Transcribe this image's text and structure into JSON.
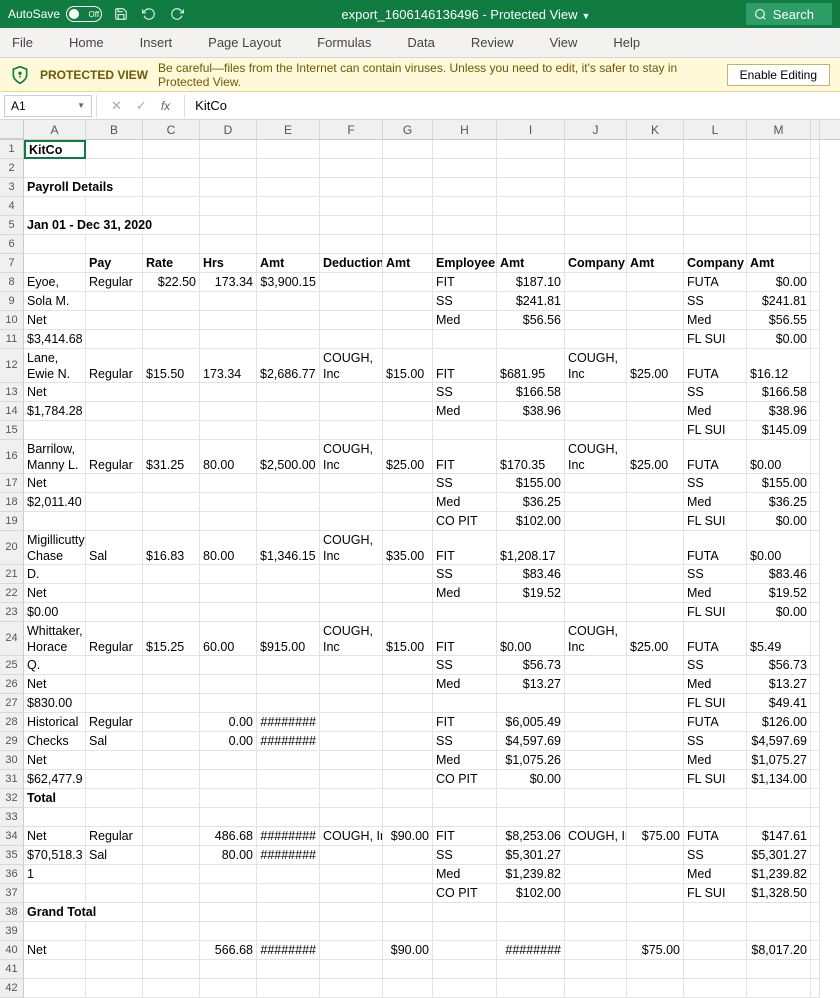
{
  "titlebar": {
    "autosave_label": "AutoSave",
    "autosave_state": "Off",
    "doc_title": "export_1606146136496  -  Protected View",
    "search_label": "Search"
  },
  "ribbon": {
    "tabs": [
      "File",
      "Home",
      "Insert",
      "Page Layout",
      "Formulas",
      "Data",
      "Review",
      "View",
      "Help"
    ]
  },
  "protected_view": {
    "title": "PROTECTED VIEW",
    "msg": "Be careful—files from the Internet can contain viruses. Unless you need to edit, it's safer to stay in Protected View.",
    "button": "Enable Editing"
  },
  "formula_bar": {
    "namebox": "A1",
    "value": "KitCo"
  },
  "columns": [
    "A",
    "B",
    "C",
    "D",
    "E",
    "F",
    "G",
    "H",
    "I",
    "J",
    "K",
    "L",
    "M",
    ""
  ],
  "rows": [
    {
      "n": 1,
      "cells": {
        "A": {
          "v": "KitCo",
          "bold": true,
          "active": true
        }
      }
    },
    {
      "n": 2,
      "cells": {}
    },
    {
      "n": 3,
      "cells": {
        "A": {
          "v": "Payroll Details",
          "bold": true,
          "span": 2
        }
      }
    },
    {
      "n": 4,
      "cells": {}
    },
    {
      "n": 5,
      "cells": {
        "A": {
          "v": "Jan 01 - Dec 31, 2020",
          "bold": true,
          "span": 3
        }
      }
    },
    {
      "n": 6,
      "cells": {}
    },
    {
      "n": 7,
      "cells": {
        "B": {
          "v": "Pay",
          "bold": true
        },
        "C": {
          "v": "Rate",
          "bold": true
        },
        "D": {
          "v": "Hrs",
          "bold": true
        },
        "E": {
          "v": "Amt",
          "bold": true
        },
        "F": {
          "v": "Deduction",
          "bold": true
        },
        "G": {
          "v": "Amt",
          "bold": true
        },
        "H": {
          "v": "Employee",
          "bold": true
        },
        "I": {
          "v": "Amt",
          "bold": true
        },
        "J": {
          "v": "Company",
          "bold": true
        },
        "K": {
          "v": "Amt",
          "bold": true
        },
        "L": {
          "v": "Company",
          "bold": true
        },
        "M": {
          "v": "Amt",
          "bold": true
        }
      }
    },
    {
      "n": 8,
      "cells": {
        "A": {
          "v": "Eyoe,"
        },
        "B": {
          "v": "Regular"
        },
        "C": {
          "v": "$22.50",
          "num": true
        },
        "D": {
          "v": "173.34",
          "num": true
        },
        "E": {
          "v": "$3,900.15",
          "num": true
        },
        "H": {
          "v": "FIT"
        },
        "I": {
          "v": "$187.10",
          "num": true
        },
        "L": {
          "v": "FUTA"
        },
        "M": {
          "v": "$0.00",
          "num": true
        }
      }
    },
    {
      "n": 9,
      "cells": {
        "A": {
          "v": "Sola M."
        },
        "H": {
          "v": "SS"
        },
        "I": {
          "v": "$241.81",
          "num": true
        },
        "L": {
          "v": "SS"
        },
        "M": {
          "v": "$241.81",
          "num": true
        }
      }
    },
    {
      "n": 10,
      "cells": {
        "A": {
          "v": "   Net"
        },
        "H": {
          "v": "Med"
        },
        "I": {
          "v": "$56.56",
          "num": true
        },
        "L": {
          "v": "Med"
        },
        "M": {
          "v": "$56.55",
          "num": true
        }
      }
    },
    {
      "n": 11,
      "cells": {
        "A": {
          "v": "$3,414.68"
        },
        "L": {
          "v": "FL SUI"
        },
        "M": {
          "v": "$0.00",
          "num": true
        }
      }
    },
    {
      "n": 12,
      "cells": {
        "A": {
          "v": "Lane, Ewie N."
        },
        "B": {
          "v": "Regular"
        },
        "C": {
          "v": "$15.50",
          "num": true
        },
        "D": {
          "v": "173.34",
          "num": true
        },
        "E": {
          "v": "$2,686.77",
          "num": true
        },
        "F": {
          "v": "COUGH, Inc"
        },
        "G": {
          "v": "$15.00",
          "num": true
        },
        "H": {
          "v": "FIT"
        },
        "I": {
          "v": "$681.95",
          "num": true
        },
        "J": {
          "v": "COUGH, Inc"
        },
        "K": {
          "v": "$25.00",
          "num": true
        },
        "L": {
          "v": "FUTA"
        },
        "M": {
          "v": "$16.12",
          "num": true
        }
      }
    },
    {
      "n": 13,
      "cells": {
        "A": {
          "v": "   Net"
        },
        "H": {
          "v": "SS"
        },
        "I": {
          "v": "$166.58",
          "num": true
        },
        "L": {
          "v": "SS"
        },
        "M": {
          "v": "$166.58",
          "num": true
        }
      }
    },
    {
      "n": 14,
      "cells": {
        "A": {
          "v": "$1,784.28"
        },
        "H": {
          "v": "Med"
        },
        "I": {
          "v": "$38.96",
          "num": true
        },
        "L": {
          "v": "Med"
        },
        "M": {
          "v": "$38.96",
          "num": true
        }
      }
    },
    {
      "n": 15,
      "cells": {
        "L": {
          "v": "FL SUI"
        },
        "M": {
          "v": "$145.09",
          "num": true
        }
      }
    },
    {
      "n": 16,
      "cells": {
        "A": {
          "v": "Barrilow, Manny L."
        },
        "B": {
          "v": "Regular"
        },
        "C": {
          "v": "$31.25",
          "num": true
        },
        "D": {
          "v": "80.00",
          "num": true
        },
        "E": {
          "v": "$2,500.00",
          "num": true
        },
        "F": {
          "v": "COUGH, Inc"
        },
        "G": {
          "v": "$25.00",
          "num": true
        },
        "H": {
          "v": "FIT"
        },
        "I": {
          "v": "$170.35",
          "num": true
        },
        "J": {
          "v": "COUGH, Inc"
        },
        "K": {
          "v": "$25.00",
          "num": true
        },
        "L": {
          "v": "FUTA"
        },
        "M": {
          "v": "$0.00",
          "num": true
        }
      }
    },
    {
      "n": 17,
      "cells": {
        "A": {
          "v": "   Net"
        },
        "H": {
          "v": "SS"
        },
        "I": {
          "v": "$155.00",
          "num": true
        },
        "L": {
          "v": "SS"
        },
        "M": {
          "v": "$155.00",
          "num": true
        }
      }
    },
    {
      "n": 18,
      "cells": {
        "A": {
          "v": "$2,011.40"
        },
        "H": {
          "v": "Med"
        },
        "I": {
          "v": "$36.25",
          "num": true
        },
        "L": {
          "v": "Med"
        },
        "M": {
          "v": "$36.25",
          "num": true
        }
      }
    },
    {
      "n": 19,
      "cells": {
        "H": {
          "v": "CO PIT"
        },
        "I": {
          "v": "$102.00",
          "num": true
        },
        "L": {
          "v": "FL SUI"
        },
        "M": {
          "v": "$0.00",
          "num": true
        }
      }
    },
    {
      "n": 20,
      "cells": {
        "A": {
          "v": "Migillicutty, Chase"
        },
        "B": {
          "v": "Sal"
        },
        "C": {
          "v": "$16.83",
          "num": true
        },
        "D": {
          "v": "80.00",
          "num": true
        },
        "E": {
          "v": "$1,346.15",
          "num": true
        },
        "F": {
          "v": "COUGH, Inc"
        },
        "G": {
          "v": "$35.00",
          "num": true
        },
        "H": {
          "v": "FIT"
        },
        "I": {
          "v": "$1,208.17",
          "num": true
        },
        "L": {
          "v": "FUTA"
        },
        "M": {
          "v": "$0.00",
          "num": true
        }
      }
    },
    {
      "n": 21,
      "cells": {
        "A": {
          "v": "D."
        },
        "H": {
          "v": "SS"
        },
        "I": {
          "v": "$83.46",
          "num": true
        },
        "L": {
          "v": "SS"
        },
        "M": {
          "v": "$83.46",
          "num": true
        }
      }
    },
    {
      "n": 22,
      "cells": {
        "A": {
          "v": "   Net"
        },
        "H": {
          "v": "Med"
        },
        "I": {
          "v": "$19.52",
          "num": true
        },
        "L": {
          "v": "Med"
        },
        "M": {
          "v": "$19.52",
          "num": true
        }
      }
    },
    {
      "n": 23,
      "cells": {
        "A": {
          "v": "$0.00"
        },
        "L": {
          "v": "FL SUI"
        },
        "M": {
          "v": "$0.00",
          "num": true
        }
      }
    },
    {
      "n": 24,
      "cells": {
        "A": {
          "v": "Whittaker, Horace"
        },
        "B": {
          "v": "Regular"
        },
        "C": {
          "v": "$15.25",
          "num": true
        },
        "D": {
          "v": "60.00",
          "num": true
        },
        "E": {
          "v": "$915.00",
          "num": true
        },
        "F": {
          "v": "COUGH, Inc"
        },
        "G": {
          "v": "$15.00",
          "num": true
        },
        "H": {
          "v": "FIT"
        },
        "I": {
          "v": "$0.00",
          "num": true
        },
        "J": {
          "v": "COUGH, Inc"
        },
        "K": {
          "v": "$25.00",
          "num": true
        },
        "L": {
          "v": "FUTA"
        },
        "M": {
          "v": "$5.49",
          "num": true
        }
      }
    },
    {
      "n": 25,
      "cells": {
        "A": {
          "v": "Q."
        },
        "H": {
          "v": "SS"
        },
        "I": {
          "v": "$56.73",
          "num": true
        },
        "L": {
          "v": "SS"
        },
        "M": {
          "v": "$56.73",
          "num": true
        }
      }
    },
    {
      "n": 26,
      "cells": {
        "A": {
          "v": "   Net"
        },
        "H": {
          "v": "Med"
        },
        "I": {
          "v": "$13.27",
          "num": true
        },
        "L": {
          "v": "Med"
        },
        "M": {
          "v": "$13.27",
          "num": true
        }
      }
    },
    {
      "n": 27,
      "cells": {
        "A": {
          "v": "$830.00"
        },
        "L": {
          "v": "FL SUI"
        },
        "M": {
          "v": "$49.41",
          "num": true
        }
      }
    },
    {
      "n": 28,
      "cells": {
        "A": {
          "v": "Historical"
        },
        "B": {
          "v": "Regular"
        },
        "D": {
          "v": "0.00",
          "num": true
        },
        "E": {
          "v": "########",
          "num": true
        },
        "H": {
          "v": "FIT"
        },
        "I": {
          "v": "$6,005.49",
          "num": true
        },
        "L": {
          "v": "FUTA"
        },
        "M": {
          "v": "$126.00",
          "num": true
        }
      }
    },
    {
      "n": 29,
      "cells": {
        "A": {
          "v": "Checks"
        },
        "B": {
          "v": "Sal"
        },
        "D": {
          "v": "0.00",
          "num": true
        },
        "E": {
          "v": "########",
          "num": true
        },
        "H": {
          "v": "SS"
        },
        "I": {
          "v": "$4,597.69",
          "num": true
        },
        "L": {
          "v": "SS"
        },
        "M": {
          "v": "$4,597.69",
          "num": true
        }
      }
    },
    {
      "n": 30,
      "cells": {
        "A": {
          "v": "   Net"
        },
        "H": {
          "v": "Med"
        },
        "I": {
          "v": "$1,075.26",
          "num": true
        },
        "L": {
          "v": "Med"
        },
        "M": {
          "v": "$1,075.27",
          "num": true
        }
      }
    },
    {
      "n": 31,
      "cells": {
        "A": {
          "v": "$62,477.9"
        },
        "H": {
          "v": "CO PIT"
        },
        "I": {
          "v": "$0.00",
          "num": true
        },
        "L": {
          "v": "FL SUI"
        },
        "M": {
          "v": "$1,134.00",
          "num": true
        }
      }
    },
    {
      "n": 32,
      "cells": {
        "A": {
          "v": "Total",
          "bold": true
        }
      }
    },
    {
      "n": 33,
      "cells": {}
    },
    {
      "n": 34,
      "cells": {
        "A": {
          "v": "Net"
        },
        "B": {
          "v": "Regular"
        },
        "D": {
          "v": "486.68",
          "num": true
        },
        "E": {
          "v": "########",
          "num": true
        },
        "F": {
          "v": "COUGH, Inc"
        },
        "G": {
          "v": "$90.00",
          "num": true
        },
        "H": {
          "v": "FIT"
        },
        "I": {
          "v": "$8,253.06",
          "num": true
        },
        "J": {
          "v": "COUGH, Inc"
        },
        "K": {
          "v": "$75.00",
          "num": true
        },
        "L": {
          "v": "FUTA"
        },
        "M": {
          "v": "$147.61",
          "num": true
        }
      }
    },
    {
      "n": 35,
      "cells": {
        "A": {
          "v": "$70,518.3"
        },
        "B": {
          "v": "Sal"
        },
        "D": {
          "v": "80.00",
          "num": true
        },
        "E": {
          "v": "########",
          "num": true
        },
        "H": {
          "v": "SS"
        },
        "I": {
          "v": "$5,301.27",
          "num": true
        },
        "L": {
          "v": "SS"
        },
        "M": {
          "v": "$5,301.27",
          "num": true
        }
      }
    },
    {
      "n": 36,
      "cells": {
        "A": {
          "v": "1"
        },
        "H": {
          "v": "Med"
        },
        "I": {
          "v": "$1,239.82",
          "num": true
        },
        "L": {
          "v": "Med"
        },
        "M": {
          "v": "$1,239.82",
          "num": true
        }
      }
    },
    {
      "n": 37,
      "cells": {
        "H": {
          "v": "CO PIT"
        },
        "I": {
          "v": "$102.00",
          "num": true
        },
        "L": {
          "v": "FL SUI"
        },
        "M": {
          "v": "$1,328.50",
          "num": true
        }
      }
    },
    {
      "n": 38,
      "cells": {
        "A": {
          "v": "Grand Total",
          "bold": true,
          "span": 2
        }
      }
    },
    {
      "n": 39,
      "cells": {}
    },
    {
      "n": 40,
      "cells": {
        "A": {
          "v": "Net"
        },
        "D": {
          "v": "566.68",
          "num": true
        },
        "E": {
          "v": "########",
          "num": true
        },
        "G": {
          "v": "$90.00",
          "num": true
        },
        "I": {
          "v": "########",
          "num": true
        },
        "K": {
          "v": "$75.00",
          "num": true
        },
        "M": {
          "v": "$8,017.20",
          "num": true
        }
      }
    },
    {
      "n": 41,
      "cells": {}
    },
    {
      "n": 42,
      "cells": {}
    }
  ],
  "colClasses": {
    "A": "cA",
    "B": "cB",
    "C": "cC",
    "D": "cD",
    "E": "cE",
    "F": "cF",
    "G": "cG",
    "H": "cH",
    "I": "cI",
    "J": "cJ",
    "K": "cK",
    "L": "cL",
    "M": "cM",
    "": "cN"
  }
}
